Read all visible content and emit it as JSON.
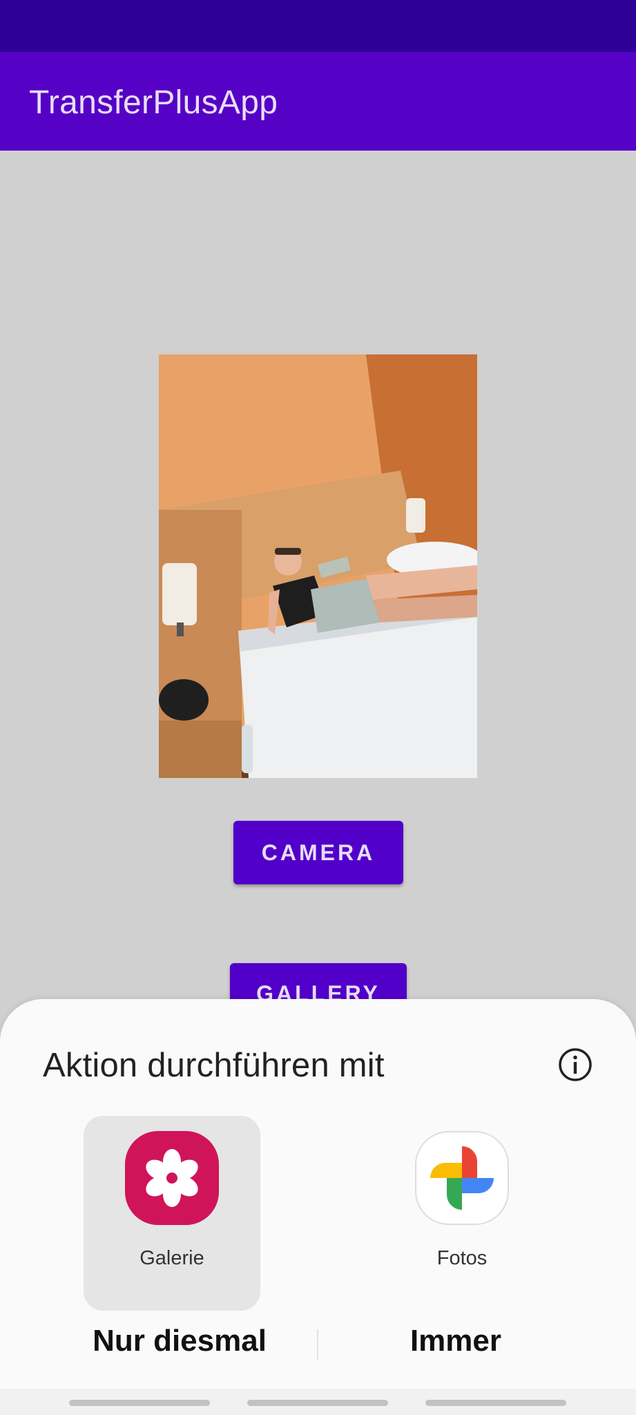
{
  "app_bar": {
    "title": "TransferPlusApp"
  },
  "main": {
    "camera_button": "CAMERA",
    "gallery_button": "GALLERY"
  },
  "sheet": {
    "title": "Aktion durchführen mit",
    "apps": [
      {
        "label": "Galerie",
        "icon": "galerie-flower-icon",
        "selected": true,
        "color": "#d0145a"
      },
      {
        "label": "Fotos",
        "icon": "google-photos-pinwheel-icon",
        "selected": false
      }
    ],
    "actions": {
      "once": "Nur diesmal",
      "always": "Immer"
    }
  },
  "colors": {
    "status_bar": "#2f0098",
    "app_bar": "#5502c6",
    "button": "#5200c9",
    "background": "#d0d0d0"
  }
}
